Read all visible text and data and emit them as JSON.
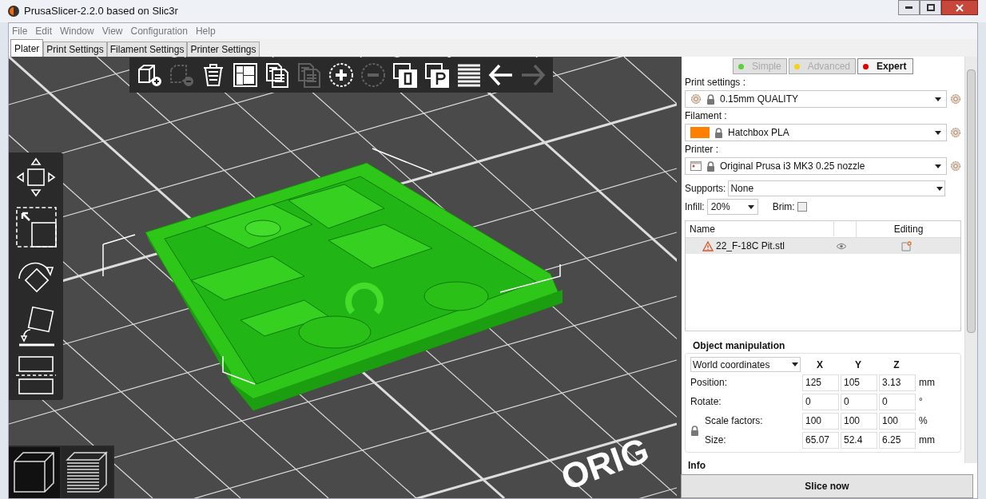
{
  "window": {
    "title": "PrusaSlicer-2.2.0 based on Slic3r"
  },
  "menu": [
    "File",
    "Edit",
    "Window",
    "View",
    "Configuration",
    "Help"
  ],
  "tabs": [
    {
      "label": "Plater",
      "selected": true
    },
    {
      "label": "Print Settings",
      "selected": false
    },
    {
      "label": "Filament Settings",
      "selected": false
    },
    {
      "label": "Printer Settings",
      "selected": false
    }
  ],
  "toolbar": [
    {
      "kind": "add",
      "disabled": false
    },
    {
      "kind": "remove",
      "disabled": true
    },
    {
      "kind": "clear",
      "disabled": false
    },
    {
      "kind": "arrange",
      "disabled": false
    },
    {
      "kind": "copy",
      "disabled": false
    },
    {
      "kind": "paste",
      "disabled": true
    },
    {
      "kind": "more",
      "disabled": false
    },
    {
      "kind": "fewer",
      "disabled": true
    },
    {
      "kind": "objects",
      "disabled": false
    },
    {
      "kind": "parts",
      "disabled": false
    },
    {
      "kind": "layers",
      "disabled": false
    },
    {
      "kind": "undo",
      "disabled": false
    },
    {
      "kind": "redo",
      "disabled": true
    }
  ],
  "gizmos": [
    {
      "kind": "move"
    },
    {
      "kind": "scale"
    },
    {
      "kind": "rotate"
    },
    {
      "kind": "flatten"
    },
    {
      "kind": "cut"
    }
  ],
  "view_buttons": [
    {
      "kind": "model",
      "selected": true
    },
    {
      "kind": "preview",
      "selected": false
    }
  ],
  "bed_label": "ORIG",
  "modes": [
    {
      "label": "Simple",
      "color": "#5bd03a",
      "selected": false
    },
    {
      "label": "Advanced",
      "color": "#f2d21b",
      "selected": false
    },
    {
      "label": "Expert",
      "color": "#e00000",
      "selected": true
    }
  ],
  "presets": [
    {
      "kind": "print",
      "label": "Print settings :",
      "value": "0.15mm QUALITY"
    },
    {
      "kind": "filament",
      "label": "Filament :",
      "value": "Hatchbox PLA",
      "color": "#ff8000"
    },
    {
      "kind": "printer",
      "label": "Printer :",
      "value": "Original Prusa i3 MK3 0.25 nozzle"
    }
  ],
  "supports": {
    "label": "Supports:",
    "value": "None"
  },
  "infill": {
    "label": "Infill:",
    "value": "20%"
  },
  "brim": {
    "label": "Brim:",
    "checked": false
  },
  "objects": {
    "columns": [
      "Name",
      "Editing"
    ],
    "rows": [
      {
        "name": "22_F-18C Pit.stl",
        "warning": true,
        "selected": true
      }
    ]
  },
  "manipulation": {
    "title": "Object manipulation",
    "coords": "World coordinates",
    "axes": [
      "X",
      "Y",
      "Z"
    ],
    "rows": [
      {
        "kind": "plain",
        "label": "Position:",
        "values": [
          "125",
          "105",
          "3.13"
        ],
        "unit": "mm"
      },
      {
        "kind": "plain",
        "label": "Rotate:",
        "values": [
          "0",
          "0",
          "0"
        ],
        "unit": "°"
      },
      {
        "kind": "scale",
        "label": "Scale factors:",
        "values": [
          "100",
          "100",
          "100"
        ],
        "unit": "%"
      },
      {
        "kind": "scale",
        "label": "Size:",
        "values": [
          "65.07",
          "52.4",
          "6.25"
        ],
        "unit": "mm"
      }
    ]
  },
  "info": {
    "title": "Info"
  },
  "slice_button": "Slice now"
}
